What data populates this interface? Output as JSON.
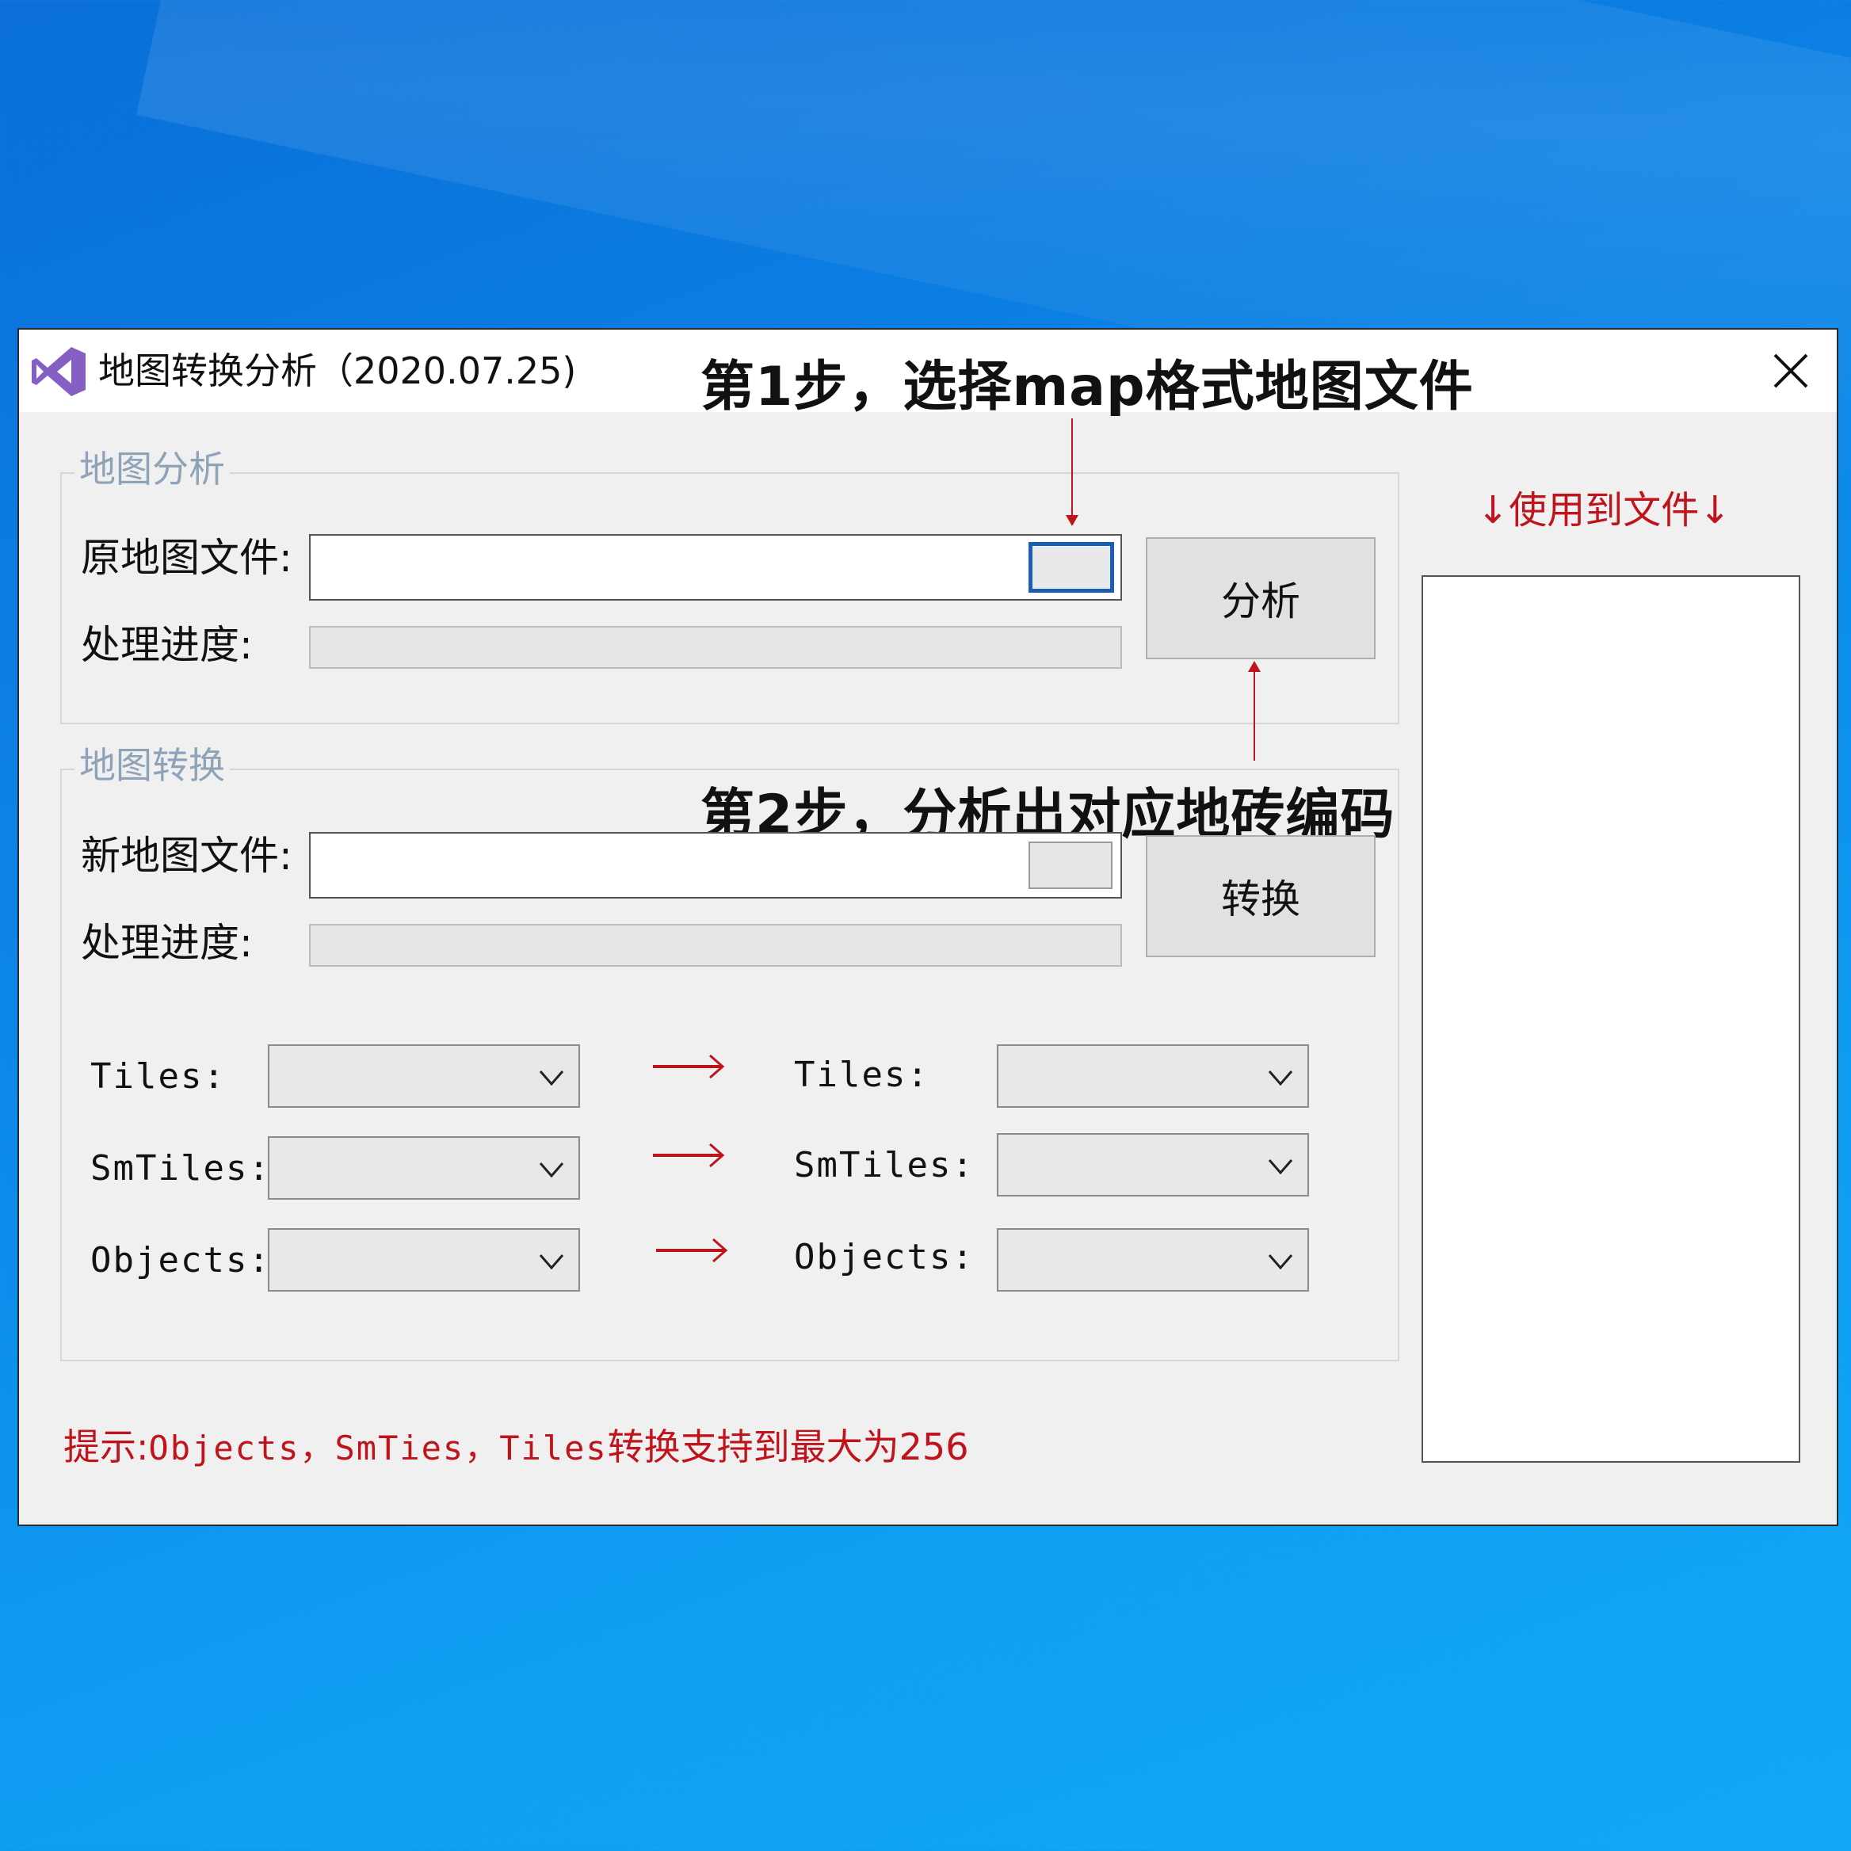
{
  "window": {
    "title": "地图转换分析（2020.07.25)",
    "close_symbol": "✕"
  },
  "annotations": {
    "step1": "第1步，选择map格式地图文件",
    "step2": "第2步，分析出对应地砖编码"
  },
  "analysis_group": {
    "legend": "地图分析",
    "source_file_label": "原地图文件:",
    "source_file_value": "",
    "progress_label": "处理进度:",
    "progress": 0,
    "analyze_button": "分析"
  },
  "convert_group": {
    "legend": "地图转换",
    "new_file_label": "新地图文件:",
    "new_file_value": "",
    "progress_label": "处理进度:",
    "progress": 0,
    "convert_button": "转换",
    "mappings": [
      {
        "left_label": "Tiles:",
        "left_value": "",
        "right_label": "Tiles:",
        "right_value": ""
      },
      {
        "left_label": "SmTiles:",
        "left_value": "",
        "right_label": "SmTiles:",
        "right_value": ""
      },
      {
        "left_label": "Objects:",
        "left_value": "",
        "right_label": "Objects:",
        "right_value": ""
      }
    ]
  },
  "hint": {
    "prefix": "提示:",
    "mono_part": "Objects，SmTies，Tiles",
    "suffix": "转换支持到最大为256"
  },
  "used_files": {
    "label": "↓使用到文件↓",
    "items": []
  },
  "colors": {
    "accent_red": "#c0141c",
    "focus_blue": "#1a5fb4",
    "window_bg": "#f0f0f0",
    "desktop_blue": "#0c86e8"
  },
  "icons": {
    "app": "visual-studio-icon",
    "close": "close-icon",
    "dropdown": "chevron-down-icon",
    "mapping": "red-arrow-icon"
  }
}
